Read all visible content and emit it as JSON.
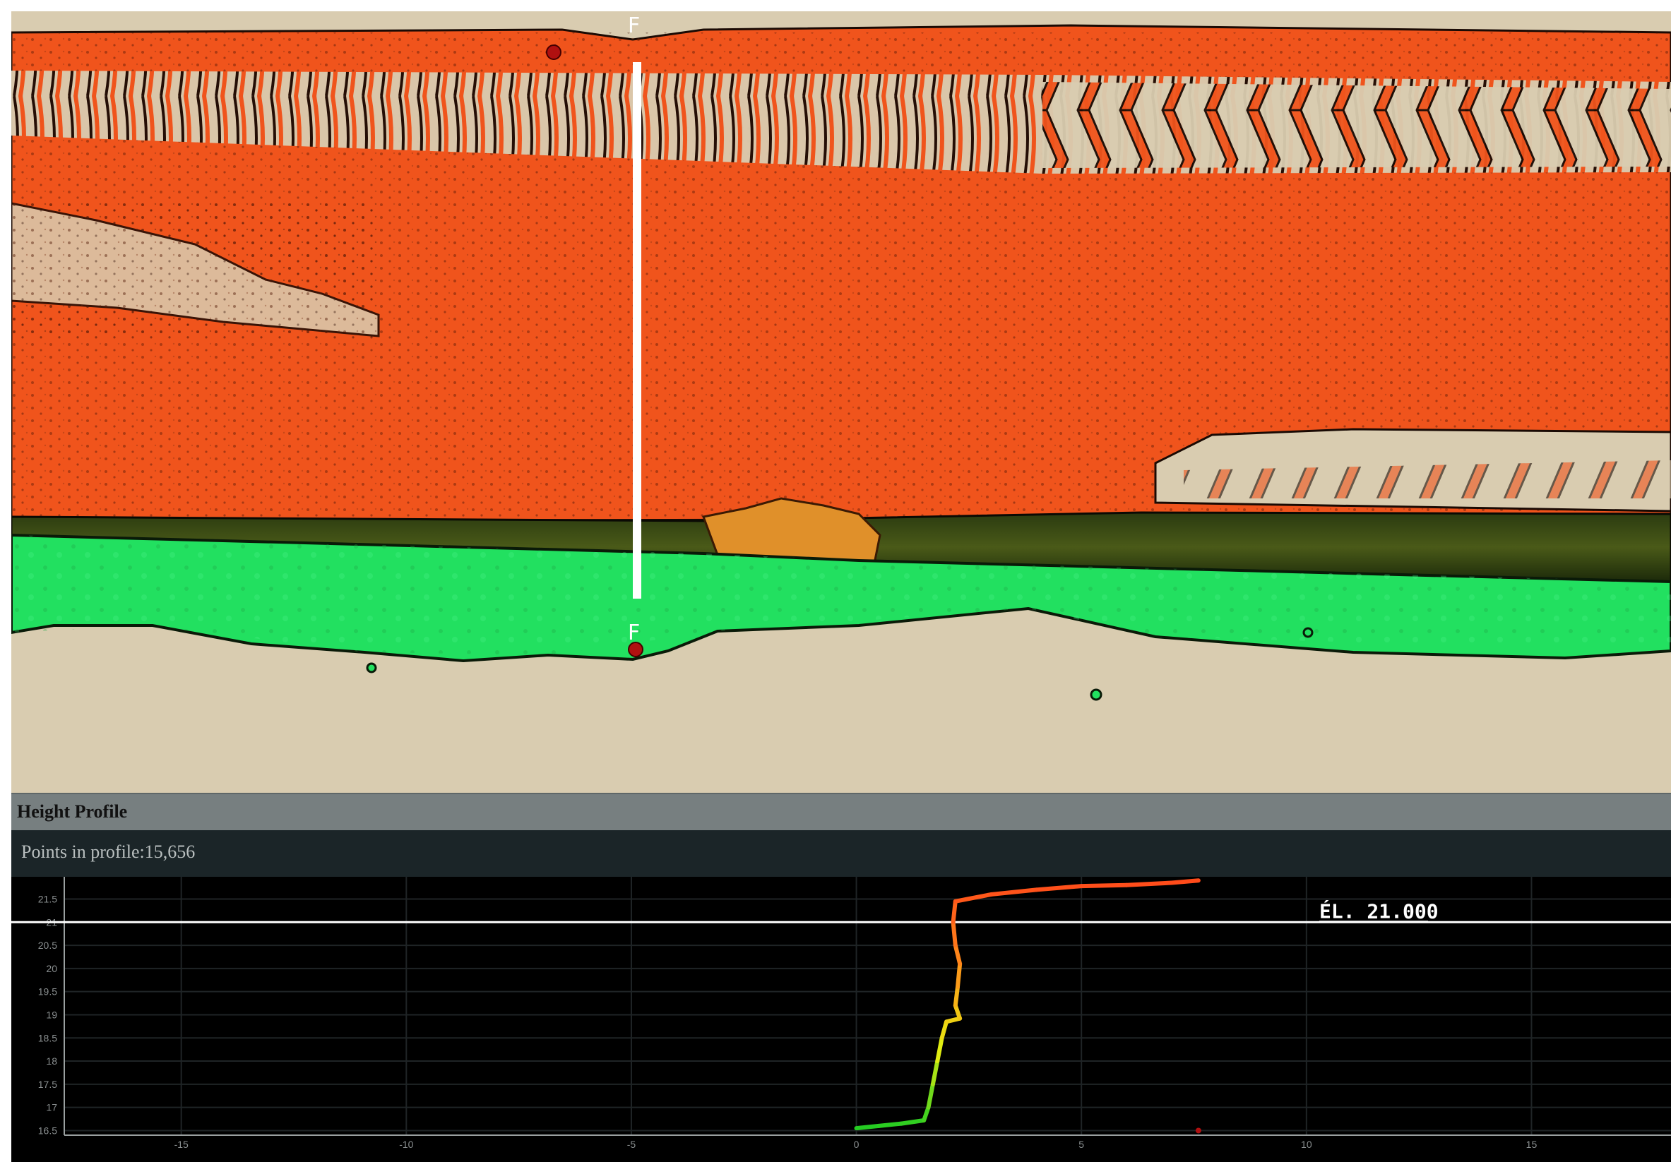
{
  "viewport": {
    "section_marker_top": "F",
    "section_marker_bottom": "F",
    "colors": {
      "background": "#d9ccb0",
      "upper_cloud": "#f0541c",
      "lower_cloud": "#22e060",
      "section_line": "#ffffff"
    }
  },
  "profile": {
    "title": "Height Profile",
    "points_text": "Points in profile:15,656",
    "elevation_label": "ÉL. 21.000",
    "colors": {
      "background": "#000000",
      "grid": "#1f2426",
      "header": "#777f80",
      "info_bar": "#1b2528"
    }
  },
  "chart_data": {
    "type": "line",
    "x_ticks": [
      -15,
      -10,
      -5,
      0,
      5,
      10,
      15
    ],
    "y_ticks": [
      16.5,
      17,
      17.5,
      18,
      18.5,
      19,
      19.5,
      20,
      20.5,
      21,
      21.5
    ],
    "xlim": [
      -17.6,
      18.1
    ],
    "ylim": [
      16.4,
      21.98
    ],
    "grid": true,
    "reference_line": {
      "y": 21.0,
      "label": "ÉL. 21.000",
      "color": "#ffffff"
    },
    "series": [
      {
        "points": [
          [
            0.0,
            16.55
          ],
          [
            0.5,
            16.6
          ],
          [
            1.0,
            16.65
          ],
          [
            1.5,
            16.72
          ],
          [
            1.6,
            17.0
          ],
          [
            1.7,
            17.5
          ],
          [
            1.8,
            18.0
          ],
          [
            1.9,
            18.5
          ],
          [
            2.0,
            18.85
          ],
          [
            2.3,
            18.92
          ],
          [
            2.2,
            19.2
          ],
          [
            2.25,
            19.6
          ],
          [
            2.3,
            20.1
          ],
          [
            2.2,
            20.5
          ],
          [
            2.15,
            21.0
          ],
          [
            2.2,
            21.45
          ],
          [
            3.0,
            21.6
          ],
          [
            4.0,
            21.7
          ],
          [
            5.0,
            21.78
          ],
          [
            6.0,
            21.8
          ],
          [
            7.0,
            21.85
          ],
          [
            7.6,
            21.9
          ]
        ],
        "color_stops": [
          "#22cc22",
          "#e8ee10",
          "#ff8c1a",
          "#ff4a1a"
        ]
      }
    ]
  }
}
